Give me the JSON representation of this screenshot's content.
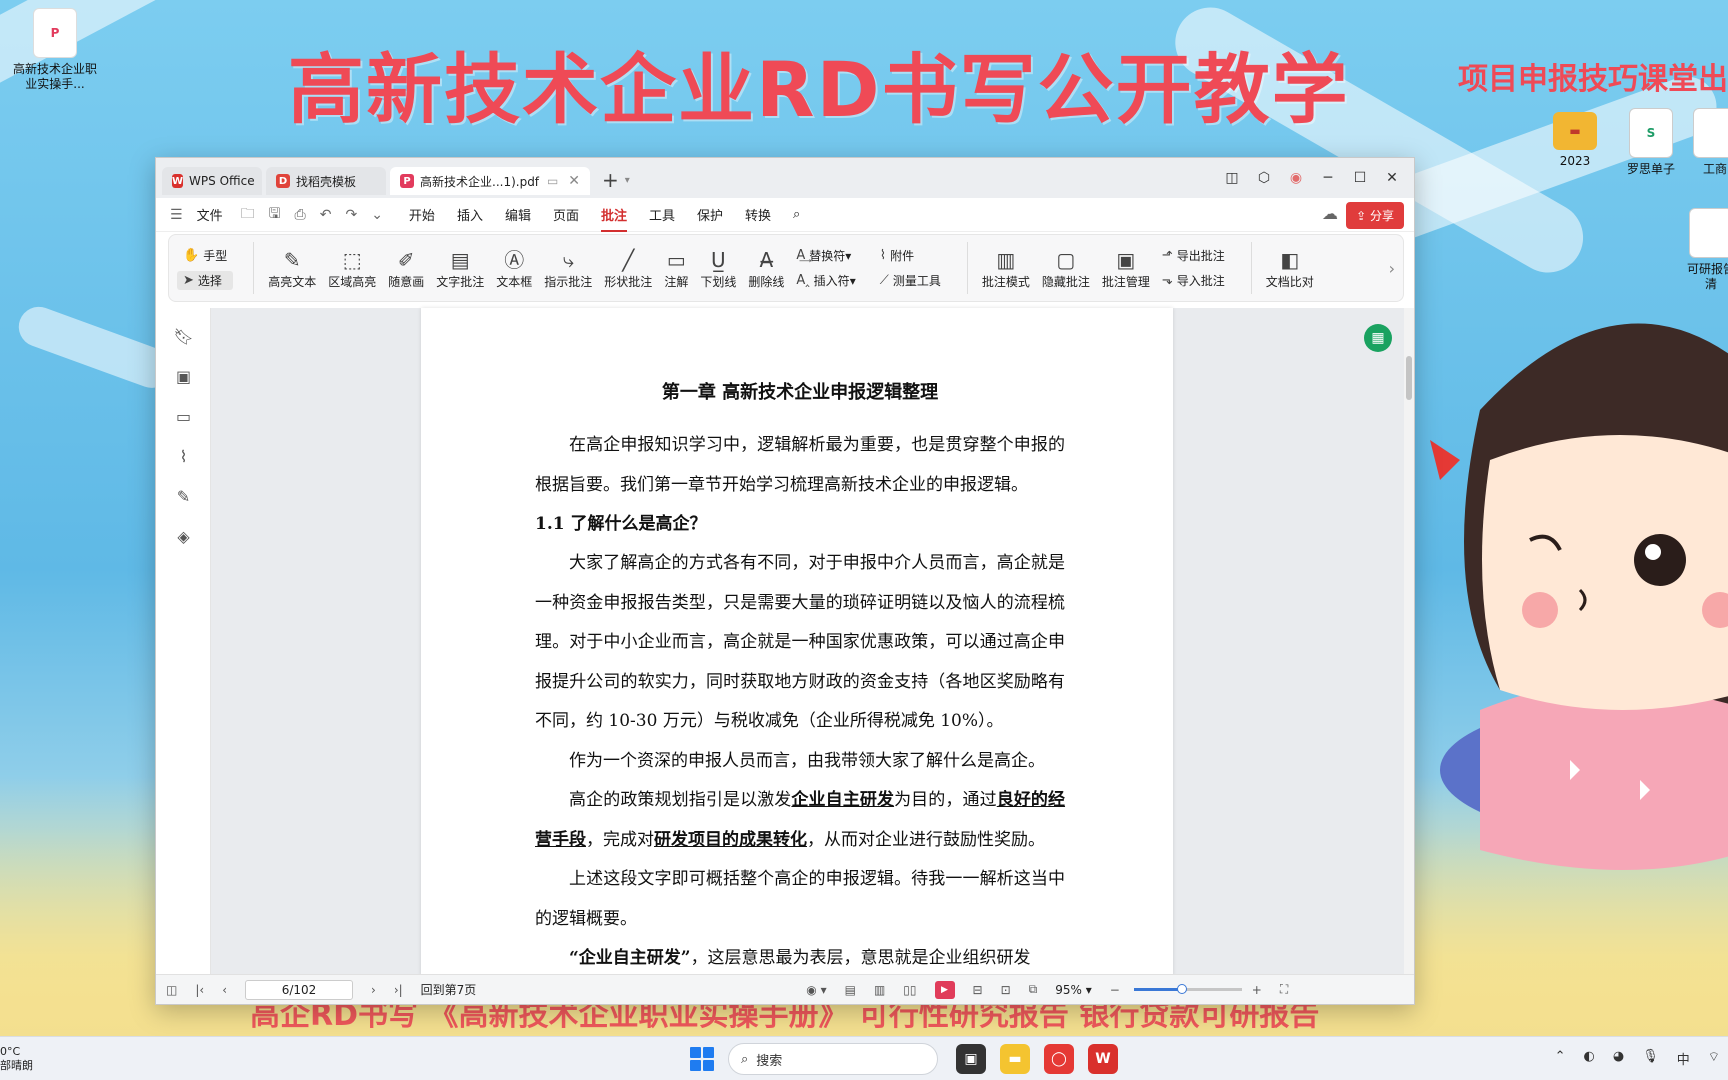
{
  "desktop": {
    "banner_title": "高新技术企业RD书写公开教学",
    "banner_subtitle": "项目申报技巧课堂出品",
    "bottom_banner": "高企RD书写   《高新技术企业职业实操手册》   可行性研究报告   银行贷款可研报告",
    "icons": [
      {
        "label": "高新技术企业职业实操手...",
        "color": "#e23b5d",
        "glyph": "P"
      },
      {
        "label": "2023",
        "color": "#f2b632",
        "glyph": "▬"
      },
      {
        "label": "罗思单子",
        "color": "#1e9c67",
        "glyph": "S"
      },
      {
        "label": "工商",
        "color": "#cccccc",
        "glyph": ""
      },
      {
        "label": "可研报告清",
        "color": "#cccccc",
        "glyph": ""
      }
    ]
  },
  "window": {
    "tabs": [
      {
        "label": "WPS Office",
        "icon": "wps-logo-icon",
        "color": "#d9302c"
      },
      {
        "label": "找稻壳模板",
        "icon": "docer-icon",
        "color": "#e0433a"
      },
      {
        "label": "高新技术企业...1).pdf",
        "icon": "pdf-icon",
        "color": "#e23b5d"
      }
    ],
    "menu": {
      "file": "文件",
      "items": [
        "开始",
        "插入",
        "编辑",
        "页面",
        "批注",
        "工具",
        "保护",
        "转换"
      ],
      "active": "批注",
      "share": "分享"
    },
    "ribbon": {
      "hand": "手型",
      "select": "选择",
      "buttons": [
        {
          "label": "高亮文本",
          "icon": "✎",
          "name": "highlight-text"
        },
        {
          "label": "区域高亮",
          "icon": "⬚",
          "name": "area-highlight"
        },
        {
          "label": "随意画",
          "icon": "✐",
          "name": "freehand"
        },
        {
          "label": "文字批注",
          "icon": "▤",
          "name": "text-annotation"
        },
        {
          "label": "文本框",
          "icon": "Ⓐ",
          "name": "text-box"
        },
        {
          "label": "指示批注",
          "icon": "⤷",
          "name": "pointer-annotation"
        },
        {
          "label": "形状批注",
          "icon": "╱",
          "name": "shape-annotation"
        },
        {
          "label": "注解",
          "icon": "▭",
          "name": "note"
        },
        {
          "label": "下划线",
          "icon": "U̲",
          "name": "underline"
        },
        {
          "label": "删除线",
          "icon": "A̶",
          "name": "strikethrough"
        }
      ],
      "replace": "替换符",
      "insert": "插入符",
      "attach": "附件",
      "measure": "测量工具",
      "buttons2": [
        {
          "label": "批注模式",
          "icon": "▥",
          "name": "annotation-mode"
        },
        {
          "label": "隐藏批注",
          "icon": "▢",
          "name": "hide-annotations"
        },
        {
          "label": "批注管理",
          "icon": "▣",
          "name": "annotation-manage"
        }
      ],
      "export": "导出批注",
      "import": "导入批注",
      "compare": "文档比对"
    },
    "document": {
      "chapter": "第一章  高新技术企业申报逻辑整理",
      "p1": "在高企申报知识学习中，逻辑解析最为重要，也是贯穿整个申报的根据旨要。我们第一章节开始学习梳理高新技术企业的申报逻辑。",
      "h1": "1.1 了解什么是高企？",
      "p2": "大家了解高企的方式各有不同，对于申报中介人员而言，高企就是一种资金申报报告类型，只是需要大量的琐碎证明链以及恼人的流程梳理。对于中小企业而言，高企就是一种国家优惠政策，可以通过高企申报提升公司的软实力，同时获取地方财政的资金支持（各地区奖励略有不同，约 10-30 万元）与税收减免（企业所得税减免 10%）。",
      "p3": "作为一个资深的申报人员而言，由我带领大家了解什么是高企。",
      "p4_a": "高企的政策规划指引是以激发",
      "p4_b": "企业自主研发",
      "p4_c": "为目的，通过",
      "p4_d": "良好的经营手段",
      "p4_e": "，完成对",
      "p4_f": "研发项目的成果转化",
      "p4_g": "，从而对企业进行鼓励性奖励。",
      "p5": "上述这段文字即可概括整个高企的申报逻辑。待我一一解析这当中的逻辑概要。",
      "p6_a": "“企业自主研发”",
      "p6_b": "，这层意思最为表层，意思就是企业组织研发"
    },
    "status": {
      "page": "6/102",
      "goto": "回到第7页",
      "zoom": "95%",
      "zoom_fraction": 0.45
    }
  },
  "taskbar": {
    "weather_temp": "0°C",
    "weather_desc": "部晴朗",
    "search": "搜索"
  }
}
